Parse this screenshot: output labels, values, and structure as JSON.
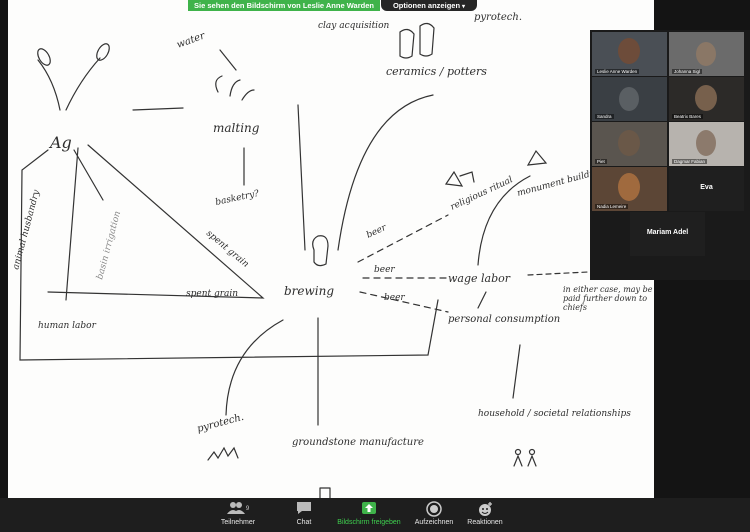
{
  "zoom": {
    "share_banner": "Sie sehen den Bildschirm von Leslie Anne Warden",
    "options_label": "Optionen anzeigen"
  },
  "whiteboard": {
    "labels": {
      "ag": "Ag",
      "water": "water",
      "malting": "malting",
      "basketry": "basketry?",
      "clay_acquisition": "clay acquisition",
      "ceramics_potters": "ceramics / potters",
      "pyrotech_top": "pyrotech.",
      "animal_husbandry": "animal husbandry",
      "basin_irrigation": "basin irrigation",
      "spent_grain_diag": "spent grain",
      "spent_grain": "spent grain",
      "human_labor": "human labor",
      "brewing": "brewing",
      "beer_1": "beer",
      "beer_2": "beer",
      "beer_3": "beer",
      "religious_ritual": "religious ritual",
      "monument_building": "monument building",
      "wage_labor": "wage labor",
      "personal_consumption": "personal consumption",
      "note": "in either case, may be paid further down to chiefs",
      "household": "household / societal relationships",
      "pyrotech_bottom": "pyrotech.",
      "groundstone": "groundstone manufacture"
    }
  },
  "participants": [
    {
      "name": "Leslie Anne Warden",
      "color": "#6d4c3a"
    },
    {
      "name": "Johanna Sigl",
      "color": "#8a7766"
    },
    {
      "name": "Sandra",
      "color": "#5a5f63"
    },
    {
      "name": "Beatrix Bares",
      "color": "#77604c"
    },
    {
      "name": "Piet",
      "color": "#6a5848"
    },
    {
      "name": "Dagmar Fabian",
      "color": "#8c7a6c"
    },
    {
      "name": "Nadia Lemeire",
      "color": "#a06a3e"
    },
    {
      "name": "Eva",
      "color": ""
    },
    {
      "name": "Mariam Adel",
      "color": ""
    }
  ],
  "toolbar": {
    "participants_label": "Teilnehmer",
    "participants_count": "9",
    "chat_label": "Chat",
    "share_label": "Bildschirm freigeben",
    "record_label": "Aufzeichnen",
    "reactions_label": "Reaktionen"
  },
  "colors": {
    "share_green": "#3fb34a",
    "toolbar_bg": "#1e1e1e",
    "share_text": "#3fd14f"
  }
}
